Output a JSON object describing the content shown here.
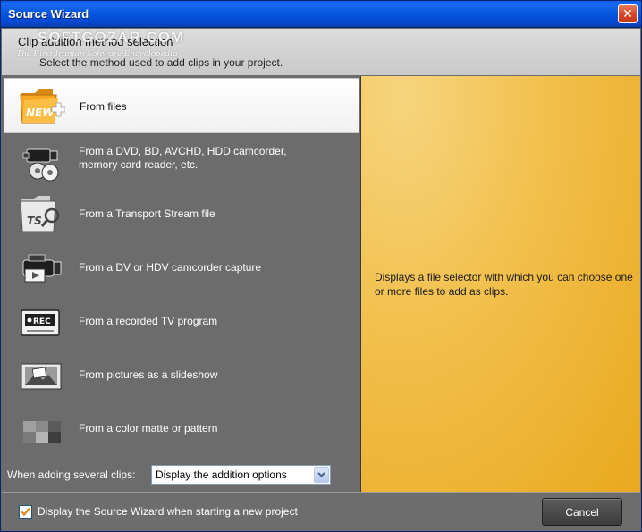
{
  "window": {
    "title": "Source Wizard"
  },
  "header": {
    "title": "Clip addition method selection",
    "subtitle": "Select the method used to add clips in your project.",
    "watermark_line1": "SOFTGOZAR.COM",
    "watermark_line2": "The First Iranian Software Encyclopedia"
  },
  "methods": [
    {
      "label": "From files",
      "icon": "new-folder-icon",
      "selected": true
    },
    {
      "label": "From a DVD, BD, AVCHD, HDD camcorder,\nmemory card reader, etc.",
      "icon": "camcorder-disc-icon"
    },
    {
      "label": "From a Transport Stream file",
      "icon": "ts-folder-icon"
    },
    {
      "label": "From a DV or HDV camcorder capture",
      "icon": "camcorder-capture-icon"
    },
    {
      "label": "From a recorded TV program",
      "icon": "tv-rec-icon"
    },
    {
      "label": "From pictures as a slideshow",
      "icon": "slideshow-icon"
    },
    {
      "label": "From a color matte or pattern",
      "icon": "color-matte-icon"
    }
  ],
  "options": {
    "label": "When adding several clips:",
    "selected": "Display the addition options"
  },
  "description": "Displays a file selector with which you can choose one or more files to add as clips.",
  "footer": {
    "checkbox_label": "Display the Source Wizard when starting a new project",
    "checkbox_checked": true,
    "cancel_label": "Cancel"
  },
  "colors": {
    "accent": "#f1bf4a",
    "titlebar": "#0758e0",
    "panel": "#6c6c6c",
    "check": "#e08a1e"
  }
}
